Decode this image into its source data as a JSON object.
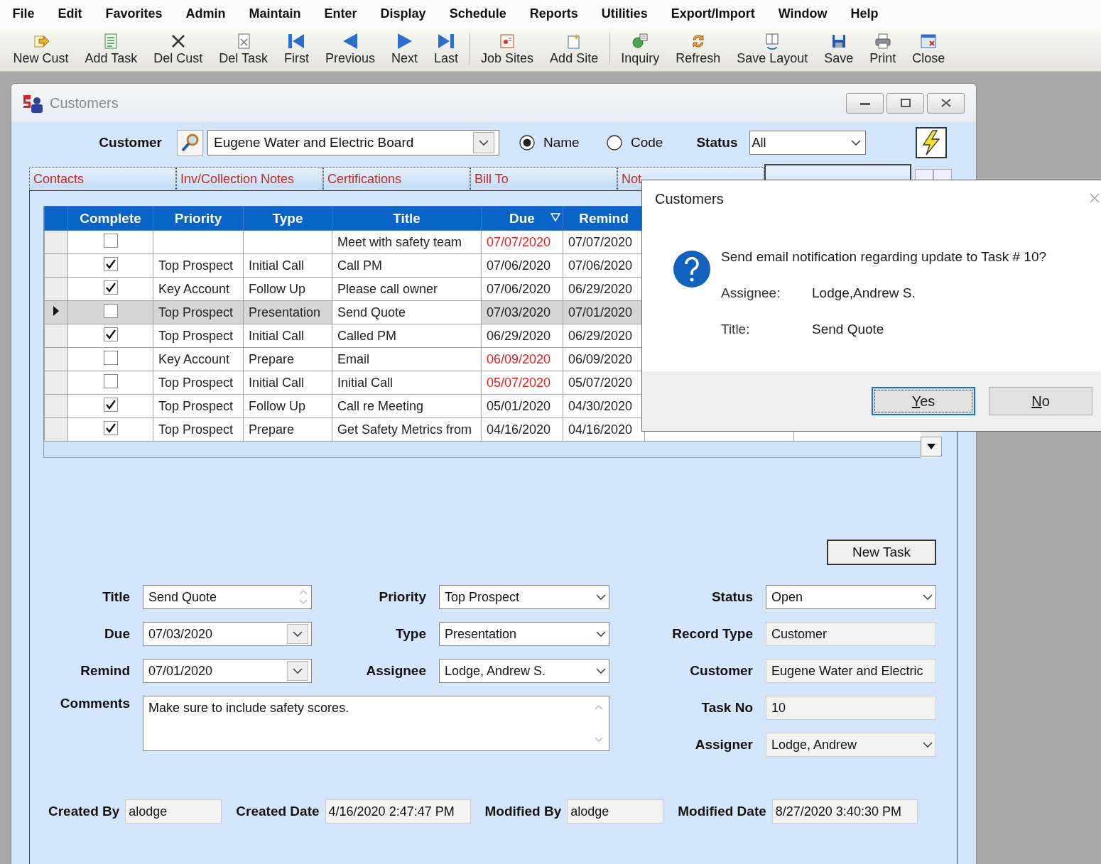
{
  "menu": [
    "File",
    "Edit",
    "Favorites",
    "Admin",
    "Maintain",
    "Enter",
    "Display",
    "Schedule",
    "Reports",
    "Utilities",
    "Export/Import",
    "Window",
    "Help"
  ],
  "toolbar": [
    [
      "New Cust",
      "Add Task",
      "Del Cust",
      "Del Task",
      "First",
      "Previous",
      "Next",
      "Last"
    ],
    [
      "Job Sites",
      "Add Site"
    ],
    [
      "Inquiry",
      "Refresh",
      "Save Layout",
      "Save",
      "Print",
      "Close"
    ]
  ],
  "window": {
    "title": "Customers",
    "customer_label": "Customer",
    "customer_value": "Eugene Water and Electric Board",
    "search_mode": [
      {
        "label": "Name",
        "selected": true
      },
      {
        "label": "Code",
        "selected": false
      }
    ],
    "status_label": "Status",
    "status_value": "All"
  },
  "tabs": [
    {
      "label": "Contacts",
      "selected": false
    },
    {
      "label": "Inv/Collection Notes",
      "selected": false
    },
    {
      "label": "Certifications",
      "selected": false
    },
    {
      "label": "Bill To",
      "selected": false
    },
    {
      "label": "Not",
      "selected": false
    },
    {
      "selected": true
    }
  ],
  "grid": {
    "columns": [
      {
        "label": "Complete",
        "filter": false
      },
      {
        "label": "Priority",
        "filter": false
      },
      {
        "label": "Type",
        "filter": false
      },
      {
        "label": "Title",
        "filter": false
      },
      {
        "label": "Due",
        "filter": true
      },
      {
        "label": "Remind",
        "filter": false
      }
    ],
    "rows": [
      {
        "complete": false,
        "current": false,
        "title": "Meet with safety team",
        "due": "07/07/2020",
        "overdue": true,
        "remind": "07/07/2020"
      },
      {
        "complete": true,
        "current": false,
        "priority": "Top Prospect",
        "type": "Initial Call",
        "title": "Call PM",
        "due": "07/06/2020",
        "overdue": false,
        "remind": "07/06/2020"
      },
      {
        "complete": true,
        "current": false,
        "priority": "Key Account",
        "type": "Follow Up",
        "title": "Please call owner",
        "due": "07/06/2020",
        "overdue": false,
        "remind": "06/29/2020"
      },
      {
        "complete": false,
        "current": true,
        "priority": "Top Prospect",
        "type": "Presentation",
        "title": "Send Quote",
        "due": "07/03/2020",
        "overdue": false,
        "remind": "07/01/2020"
      },
      {
        "complete": true,
        "current": false,
        "priority": "Top Prospect",
        "type": "Initial Call",
        "title": "Called PM",
        "due": "06/29/2020",
        "overdue": false,
        "remind": "06/29/2020"
      },
      {
        "complete": false,
        "current": false,
        "priority": "Key Account",
        "type": "Prepare",
        "title": "Email",
        "due": "06/09/2020",
        "overdue": true,
        "remind": "06/09/2020"
      },
      {
        "complete": false,
        "current": false,
        "priority": "Top Prospect",
        "type": "Initial Call",
        "title": "Initial Call",
        "due": "05/07/2020",
        "overdue": true,
        "remind": "05/07/2020"
      },
      {
        "complete": true,
        "current": false,
        "priority": "Top Prospect",
        "type": "Follow Up",
        "title": "Call re Meeting",
        "due": "05/01/2020",
        "overdue": false,
        "remind": "04/30/2020"
      },
      {
        "complete": true,
        "current": false,
        "priority": "Top Prospect",
        "type": "Prepare",
        "title": "Get Safety Metrics from",
        "due": "04/16/2020",
        "overdue": false,
        "remind": "04/16/2020"
      }
    ]
  },
  "new_task_button": "New Task",
  "task_form": {
    "left": [
      {
        "label": "Title",
        "value": "Send Quote",
        "kind": "spin"
      },
      {
        "label": "Due",
        "value": "07/03/2020",
        "kind": "date"
      },
      {
        "label": "Remind",
        "value": "07/01/2020",
        "kind": "date"
      }
    ],
    "middle": [
      {
        "label": "Priority",
        "value": "Top Prospect",
        "kind": "combo"
      },
      {
        "label": "Type",
        "value": "Presentation",
        "kind": "combo"
      },
      {
        "label": "Assignee",
        "value": "Lodge, Andrew S.",
        "kind": "combo"
      }
    ],
    "comments": {
      "label": "Comments",
      "value": "Make sure to include safety scores."
    },
    "right": [
      {
        "label": "Status",
        "value": "Open",
        "kind": "combo"
      },
      {
        "label": "Record Type",
        "value": "Customer",
        "kind": "readonly"
      },
      {
        "label": "Customer",
        "value": "Eugene Water and Electric",
        "kind": "readonly"
      },
      {
        "label": "Task No",
        "value": "10",
        "kind": "readonly"
      },
      {
        "label": "Assigner",
        "value": "Lodge, Andrew",
        "kind": "readonly_combo"
      }
    ]
  },
  "audit": [
    {
      "label": "Created By",
      "value": "alodge"
    },
    {
      "label": "Created Date",
      "value": "4/16/2020 2:47:47 PM"
    },
    {
      "label": "Modified By",
      "value": "alodge"
    },
    {
      "label": "Modified Date",
      "value": "8/27/2020 3:40:30 PM"
    }
  ],
  "dialog": {
    "title": "Customers",
    "question": "Send email notification regarding update to Task # 10?",
    "details": [
      {
        "label": "Assignee:",
        "value": "Lodge,Andrew S."
      },
      {
        "label": "Title:",
        "value": "Send Quote"
      }
    ],
    "buttons": [
      {
        "label": "Yes",
        "default": true
      },
      {
        "label": "No",
        "default": false
      }
    ]
  }
}
